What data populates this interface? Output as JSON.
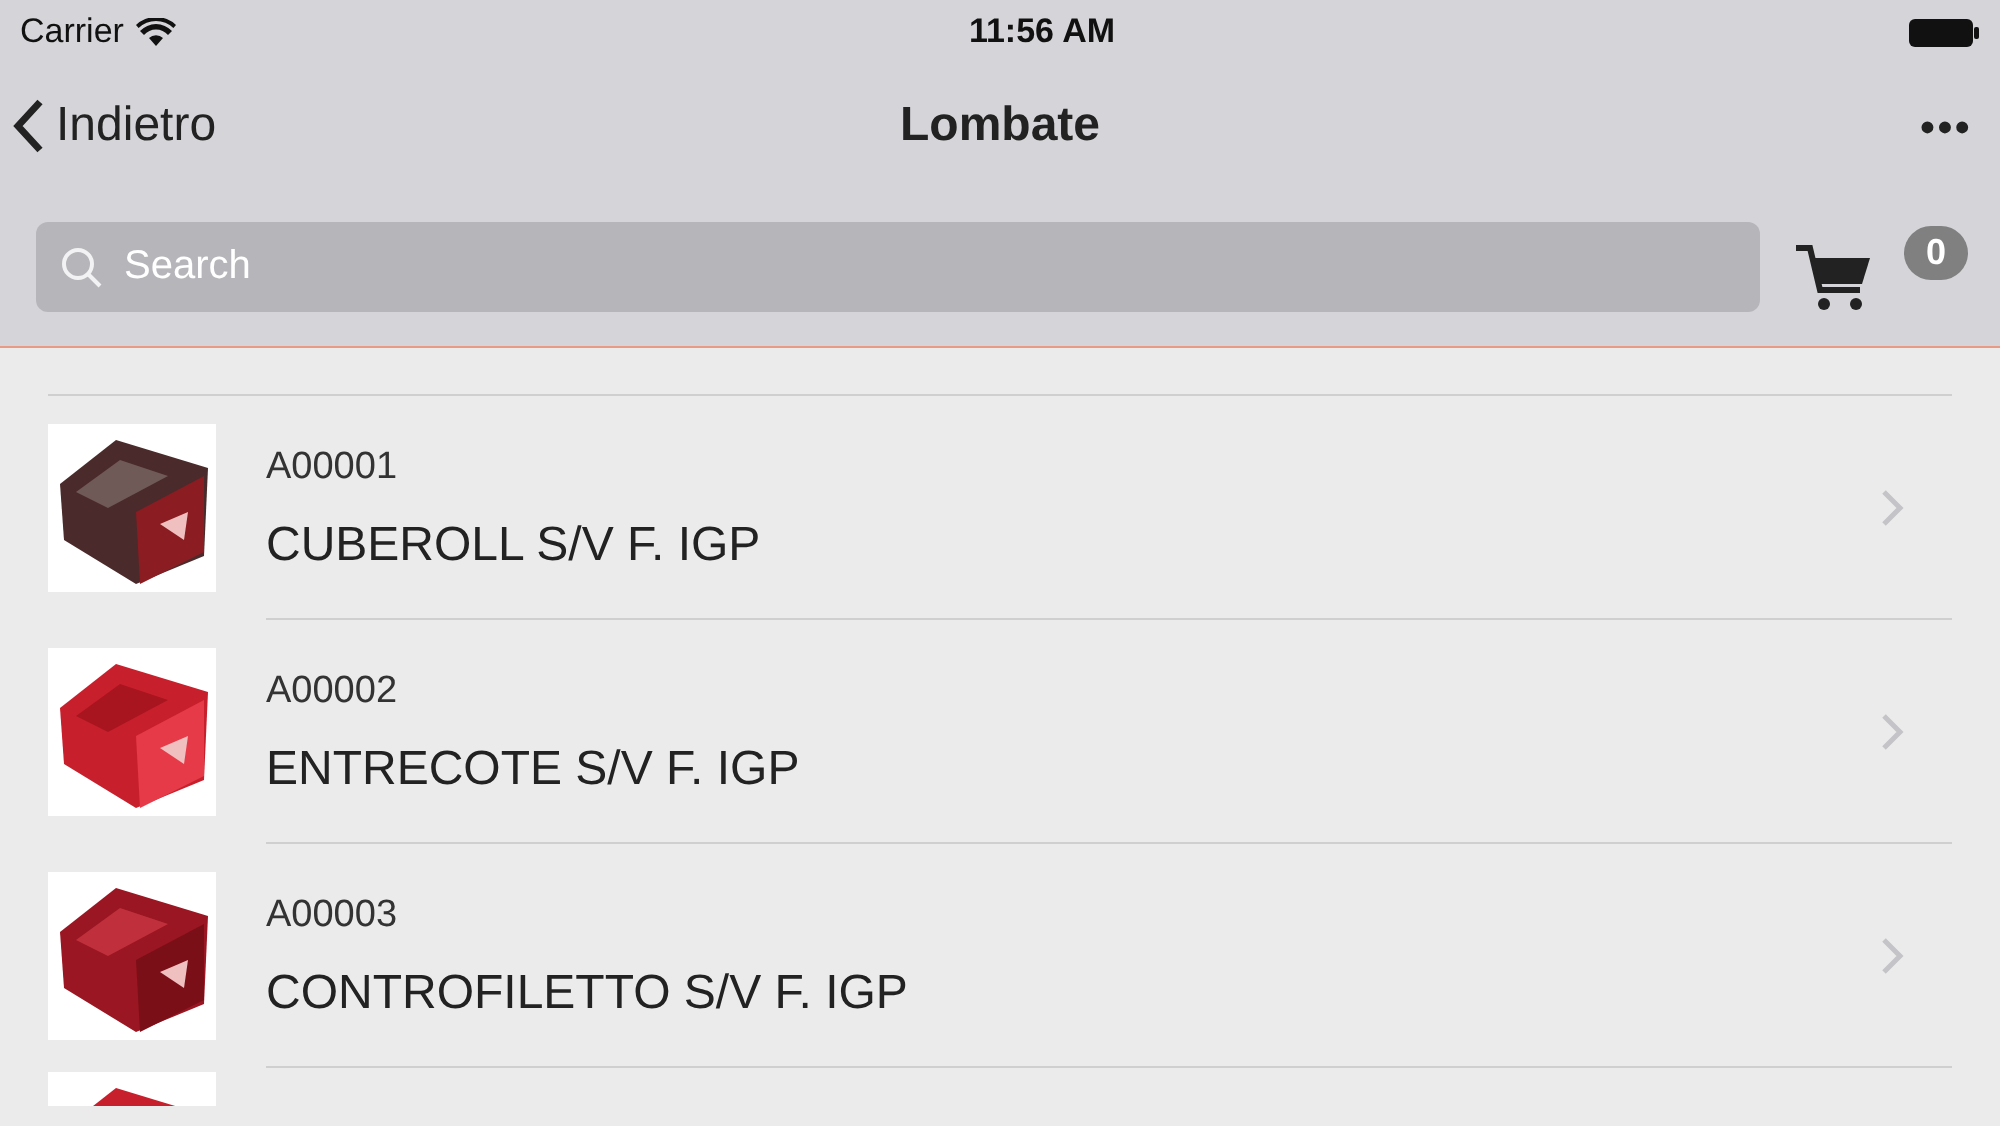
{
  "status_bar": {
    "carrier": "Carrier",
    "time": "11:56 AM"
  },
  "nav_bar": {
    "back": "Indietro",
    "title": "Lombate",
    "more": "•••"
  },
  "search": {
    "placeholder": "Search"
  },
  "cart": {
    "count": "0"
  },
  "items": [
    {
      "code": "A00001",
      "name": "CUBEROLL S/V F. IGP"
    },
    {
      "code": "A00002",
      "name": "ENTRECOTE S/V F. IGP"
    },
    {
      "code": "A00003",
      "name": "CONTROFILETTO S/V F. IGP"
    }
  ]
}
